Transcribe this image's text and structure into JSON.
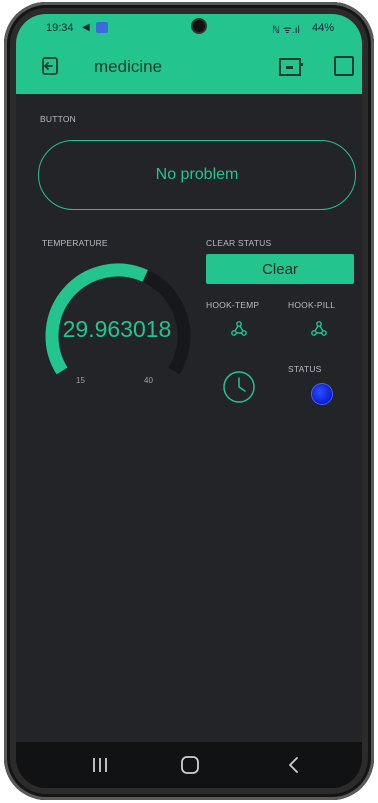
{
  "status_bar": {
    "time": "19:34",
    "signal_icons": "ℕ ᯤ.ıl",
    "battery": "44%"
  },
  "app_bar": {
    "title": "medicine"
  },
  "widgets": {
    "button": {
      "label": "BUTTON",
      "text": "No problem"
    },
    "temperature": {
      "label": "TEMPERATURE",
      "value": "29.963018",
      "min": "15",
      "max": "40",
      "level_fraction": 0.6
    },
    "clear_status": {
      "label": "CLEAR STATUS",
      "button_text": "Clear"
    },
    "hook_temp": {
      "label": "HOOK-TEMP"
    },
    "hook_pill": {
      "label": "HOOK-PILL"
    },
    "status": {
      "label": "STATUS",
      "led_color": "#0a1fd0"
    }
  },
  "colors": {
    "accent": "#23c48e",
    "background": "#232428"
  },
  "icons": {
    "back": "exit-icon",
    "device": "device-icon",
    "webhook": "webhook-icon",
    "timer": "clock-icon"
  }
}
